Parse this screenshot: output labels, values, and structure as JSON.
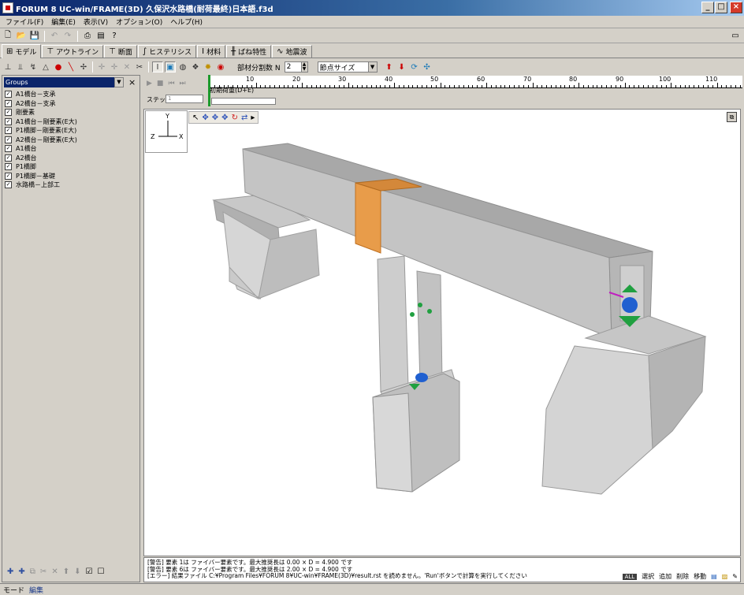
{
  "window": {
    "title": "FORUM 8  UC-win/FRAME(3D)  久保沢水路橋(耐荷最終)日本語.f3d",
    "minimize": "_",
    "maximize": "□",
    "close": "×"
  },
  "menu": [
    "ファイル(F)",
    "編集(E)",
    "表示(V)",
    "オプション(O)",
    "ヘルプ(H)"
  ],
  "tabs": [
    {
      "label": "モデル",
      "icon": "model-icon",
      "active": true
    },
    {
      "label": "アウトライン",
      "icon": "outline-icon"
    },
    {
      "label": "断面",
      "icon": "section-icon"
    },
    {
      "label": "ヒステリシス",
      "icon": "hysteresis-icon"
    },
    {
      "label": "材料",
      "icon": "material-icon"
    },
    {
      "label": "ばね特性",
      "icon": "spring-icon"
    },
    {
      "label": "地震波",
      "icon": "wave-icon"
    }
  ],
  "toolbar2": {
    "division_label": "部材分割数 N",
    "division_value": "2",
    "node_size": "節点サイズ"
  },
  "groups": {
    "selected": "Groups",
    "items": [
      "A1橋台－支承",
      "A2橋台－支承",
      "剛要素",
      "A1橋台－剛要素(E大)",
      "P1橋脚－剛要素(E大)",
      "A2橋台－剛要素(E大)",
      "A1橋台",
      "A2橋台",
      "P1橋脚",
      "P1橋脚－基礎",
      "水路橋－上部工"
    ]
  },
  "timeline": {
    "ticks": [
      "10",
      "20",
      "30",
      "40",
      "50",
      "60",
      "70",
      "80",
      "90",
      "100",
      "110"
    ],
    "step_title": "初期荷重(D+E)",
    "step_label": "ステップ",
    "step_value": "1"
  },
  "axes": {
    "y": "Y",
    "x": "X",
    "z": "Z"
  },
  "messages": [
    "[警告] 要素 1は ファイバー要素です。最大推奨長は 0.00 × D = 4.900 です",
    "[警告] 要素 6は ファイバー要素です。最大推奨長は 2.00 × D = 4.900 です",
    "[エラー] 結果ファイル C:¥Program Files¥FORUM 8¥UC-win¥FRAME(3D)¥result.rst を読めません。'Run'ボタンで計算を実行してください"
  ],
  "status": {
    "mode_label": "モード",
    "mode_value": "編集",
    "chip": "ALL",
    "tools": [
      "選択",
      "追加",
      "削除",
      "移動"
    ]
  }
}
